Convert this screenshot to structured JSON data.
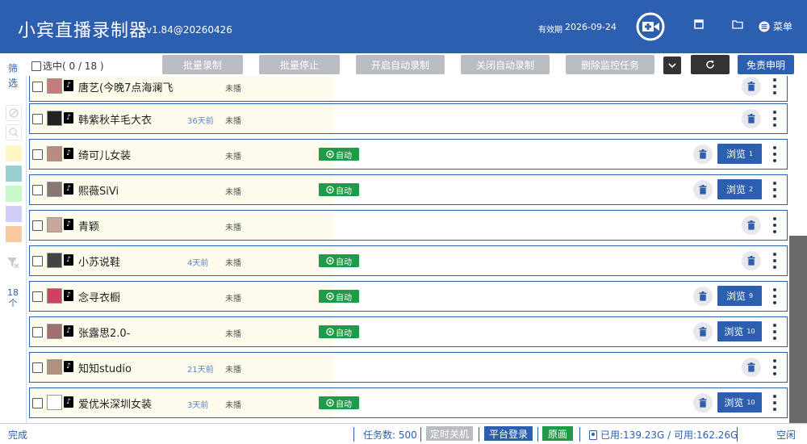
{
  "header": {
    "title": "小宾直播录制器",
    "version": "v1.84@20260426",
    "expiry_label": "有效期",
    "expiry_date": "2026-09-24",
    "menu_label": "菜单"
  },
  "sidebar": {
    "filter_label": "筛选",
    "count_label": "18个",
    "swatches": [
      "#fff7c2",
      "#9bcfcf",
      "#c8f7c8",
      "#cfcffa",
      "#fbc9a0"
    ]
  },
  "toolbar": {
    "select_all_label": "选中( 0  /  18 )",
    "batch_record": "批量录制",
    "batch_stop": "批量停止",
    "enable_auto": "开启自动录制",
    "disable_auto": "关闭自动录制",
    "delete_monitor": "删除监控任务",
    "disclaimer": "免责申明"
  },
  "rows": [
    {
      "name": "唐艺(今晚7点海澜飞",
      "days": "",
      "status": "未播",
      "auto": "",
      "browse": "",
      "browse_count": ""
    },
    {
      "name": "韩紫秋羊毛大衣",
      "days": "36天前",
      "status": "未播",
      "auto": "",
      "browse": "",
      "browse_count": ""
    },
    {
      "name": "绮可儿女装",
      "days": "",
      "status": "未播",
      "auto": "自动",
      "browse": "浏览",
      "browse_count": "1"
    },
    {
      "name": "熙薇SiVi",
      "days": "",
      "status": "未播",
      "auto": "自动",
      "browse": "浏览",
      "browse_count": "2"
    },
    {
      "name": "青颖",
      "days": "",
      "status": "未播",
      "auto": "",
      "browse": "",
      "browse_count": ""
    },
    {
      "name": "小苏说鞋",
      "days": "4天前",
      "status": "未播",
      "auto": "自动",
      "browse": "",
      "browse_count": ""
    },
    {
      "name": "念寻衣橱",
      "days": "",
      "status": "未播",
      "auto": "自动",
      "browse": "浏览",
      "browse_count": "9"
    },
    {
      "name": "张露思2.0-",
      "days": "",
      "status": "未播",
      "auto": "自动",
      "browse": "浏览",
      "browse_count": "10"
    },
    {
      "name": "知知studio",
      "days": "21天前",
      "status": "未播",
      "auto": "",
      "browse": "",
      "browse_count": ""
    },
    {
      "name": "爱优米深圳女装",
      "days": "3天前",
      "status": "未播",
      "auto": "自动",
      "browse": "浏览",
      "browse_count": "10"
    }
  ],
  "statusbar": {
    "status": "完成",
    "task_count": "任务数: 500",
    "shutdown": "定时关机",
    "platform_login": "平台登录",
    "original": "原画",
    "disk": "已用:139.23G / 可用:162.26G",
    "idle": "空闲"
  },
  "colors": {
    "brand_blue": "#2d5fb0",
    "auto_green": "#1e9b4a",
    "toolbar_gray": "#b9bcc1",
    "row_info_bg": "#fdfbec"
  }
}
